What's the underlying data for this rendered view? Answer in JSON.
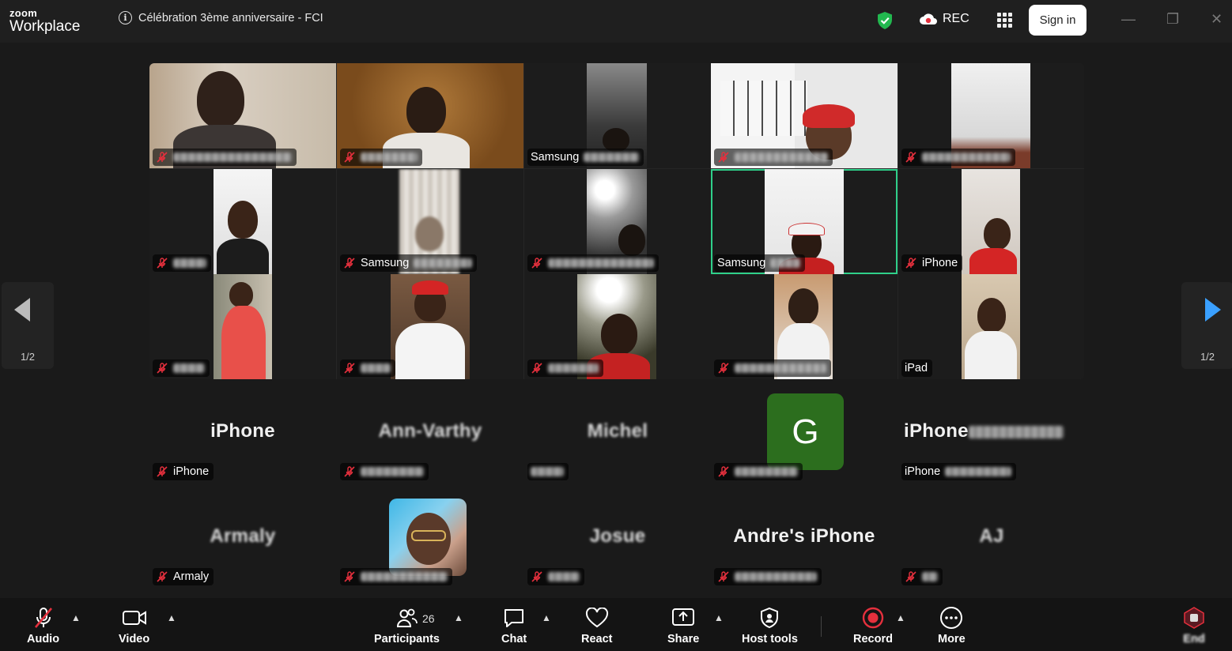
{
  "app": {
    "logo_line1": "zoom",
    "logo_line2": "Workplace"
  },
  "meeting": {
    "title": "Célébration 3ème anniversaire - FCI"
  },
  "header": {
    "rec_label": "REC",
    "signin_label": "Sign in"
  },
  "controls": {
    "minimize": "—",
    "maximize": "❐",
    "close": "✕"
  },
  "pagination": {
    "left": "1/2",
    "right": "1/2"
  },
  "video_tiles": [
    {
      "name": ""
    },
    {
      "name": ""
    },
    {
      "name": "Samsung"
    },
    {
      "name": ""
    },
    {
      "name": ""
    },
    {
      "name": ""
    },
    {
      "name": "Samsung"
    },
    {
      "name": ""
    },
    {
      "name": "Samsung"
    },
    {
      "name": "iPhone"
    },
    {
      "name": ""
    },
    {
      "name": ""
    },
    {
      "name": ""
    },
    {
      "name": ""
    },
    {
      "name": "iPad"
    }
  ],
  "audio_tiles": [
    {
      "display": "iPhone",
      "tag": "iPhone"
    },
    {
      "display": "Ann-Varthy",
      "tag": ""
    },
    {
      "display": "Michel",
      "tag": ""
    },
    {
      "display": "G",
      "tag": ""
    },
    {
      "display": "iPhone",
      "tag": "iPhone"
    },
    {
      "display": "Armaly",
      "tag": "Armaly"
    },
    {
      "display": "",
      "tag": ""
    },
    {
      "display": "Josue",
      "tag": ""
    },
    {
      "display": "Andre's iPhone",
      "tag": ""
    },
    {
      "display": "AJ",
      "tag": ""
    }
  ],
  "toolbar": {
    "audio": "Audio",
    "video": "Video",
    "participants": "Participants",
    "participants_count": "26",
    "chat": "Chat",
    "react": "React",
    "share": "Share",
    "host_tools": "Host tools",
    "record": "Record",
    "more": "More",
    "end": "End"
  },
  "colors": {
    "active_speaker": "#2fd08a",
    "shield": "#22b84f",
    "record": "#e5303d",
    "avatar_g": "#2c6e1e"
  }
}
